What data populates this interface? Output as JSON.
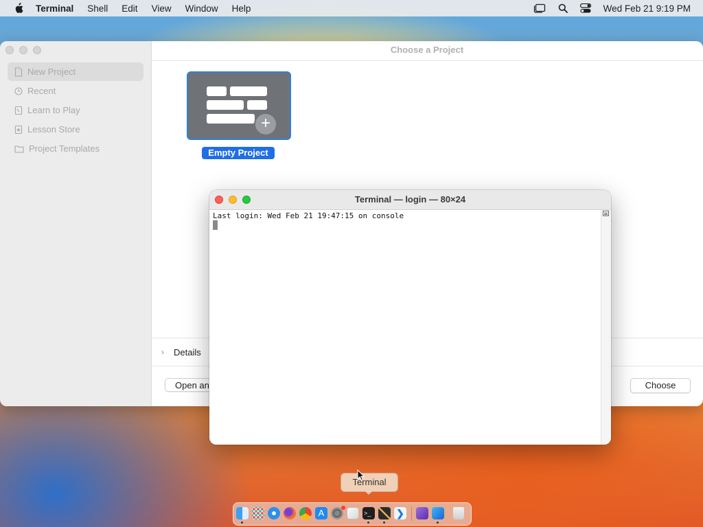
{
  "menubar": {
    "app_name": "Terminal",
    "items": [
      "Shell",
      "Edit",
      "View",
      "Window",
      "Help"
    ],
    "clock": "Wed Feb 21  9:19 PM"
  },
  "playgrounds": {
    "title": "Choose a Project",
    "sidebar": [
      {
        "label": "New Project",
        "icon": "doc-icon"
      },
      {
        "label": "Recent",
        "icon": "clock-icon"
      },
      {
        "label": "Learn to Play",
        "icon": "book-icon"
      },
      {
        "label": "Lesson Store",
        "icon": "star-icon"
      },
      {
        "label": "Project Templates",
        "icon": "folder-icon"
      }
    ],
    "tile_label": "Empty Project",
    "details_label": "Details",
    "open_button": "Open an",
    "choose_button": "Choose"
  },
  "terminal": {
    "title": "Terminal — login — 80×24",
    "line1": "Last login: Wed Feb 21 19:47:15 on console"
  },
  "tooltip": {
    "label": "Terminal"
  },
  "dock": {
    "apps": [
      "Finder",
      "Launchpad",
      "Safari",
      "Firefox",
      "Chrome",
      "App Store",
      "System Settings",
      "TextEdit",
      "Terminal",
      "Pixelmator",
      "VS Code",
      "Visual Studio",
      "Playgrounds",
      "Trash"
    ]
  },
  "colors": {
    "accent": "#1f6ee6",
    "close": "#fe5f57",
    "minimize": "#febc2e",
    "zoom": "#28c840"
  }
}
